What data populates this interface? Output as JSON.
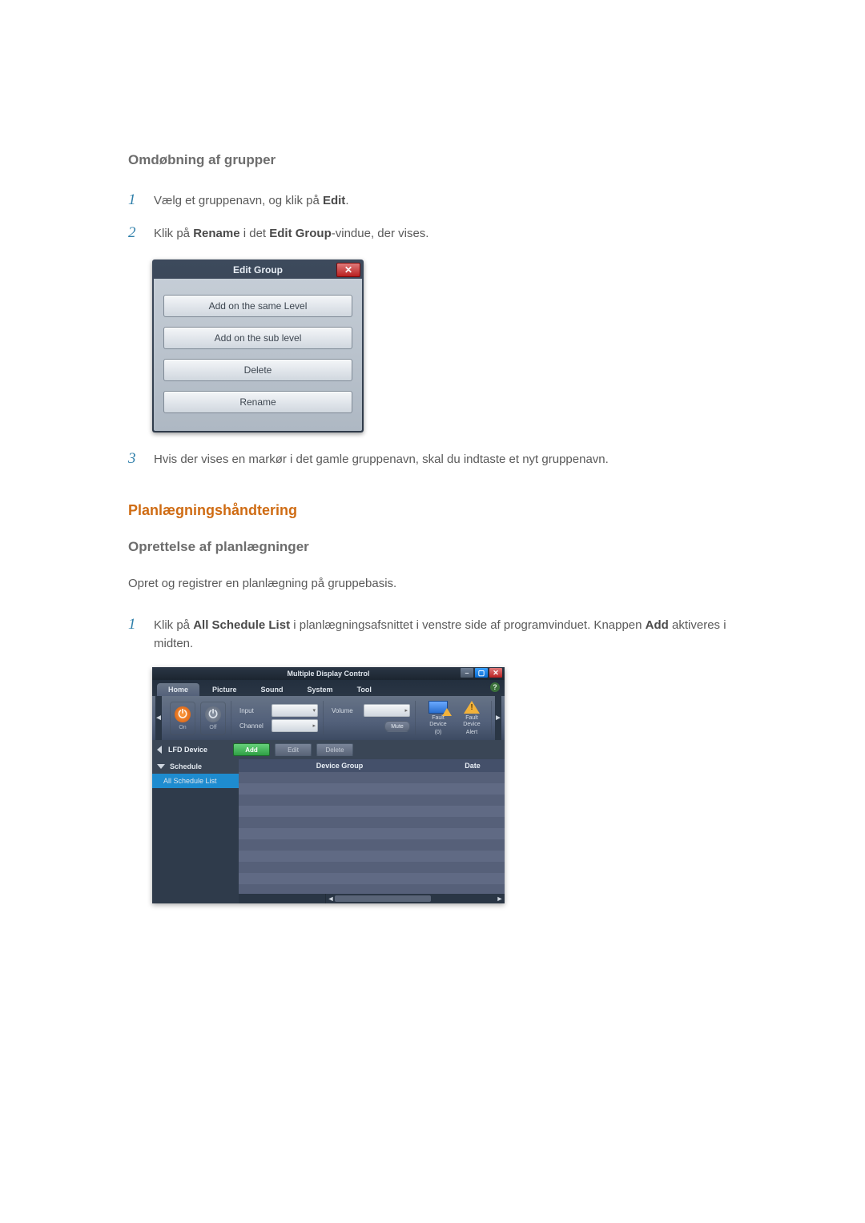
{
  "section1_title": "Omdøbning af grupper",
  "step1": {
    "pre": "Vælg et gruppenavn, og klik på ",
    "b1": "Edit",
    "post": "."
  },
  "step2": {
    "pre": "Klik på ",
    "b1": "Rename",
    "mid": " i det ",
    "b2": "Edit Group",
    "post": "-vindue, der vises."
  },
  "step3": "Hvis der vises en markør i det gamle gruppenavn, skal du indtaste et nyt gruppenavn.",
  "edit_dialog": {
    "title": "Edit Group",
    "close": "✕",
    "buttons": [
      "Add on the same Level",
      "Add on the sub level",
      "Delete",
      "Rename"
    ]
  },
  "section2_title": "Planlægningshåndtering",
  "section2_sub": "Oprettelse af planlægninger",
  "section2_p": "Opret og registrer en planlægning på gruppebasis.",
  "step4": {
    "pre": "Klik på ",
    "b1": "All Schedule List",
    "mid": " i planlægningsafsnittet i venstre side af programvinduet. Knappen ",
    "b2": "Add",
    "post": " aktiveres i midten."
  },
  "mdc": {
    "title": "Multiple Display Control",
    "win": {
      "min": "–",
      "max": "▢",
      "close": "✕"
    },
    "tabs": [
      "Home",
      "Picture",
      "Sound",
      "System",
      "Tool"
    ],
    "help": "?",
    "ribbon": {
      "edge_left": "◄",
      "edge_right": "►",
      "on": "On",
      "off": "Off",
      "power_glyph": "⏻",
      "input": "Input",
      "channel": "Channel",
      "drop": "▾",
      "spin": "▸",
      "volume": "Volume",
      "mute": "Mute",
      "fault1_l1": "Fault Device",
      "fault1_l2": "(0)",
      "fault2_l1": "Fault Device",
      "fault2_l2": "Alert",
      "ex": "!"
    },
    "midbar": {
      "lfd": "LFD Device",
      "add": "Add",
      "edit": "Edit",
      "delete": "Delete"
    },
    "side": {
      "schedule": "Schedule",
      "all_schedule": "All Schedule List"
    },
    "cols": {
      "group": "Device Group",
      "date": "Date"
    },
    "scroll": {
      "left": "◄",
      "right": "►"
    }
  }
}
